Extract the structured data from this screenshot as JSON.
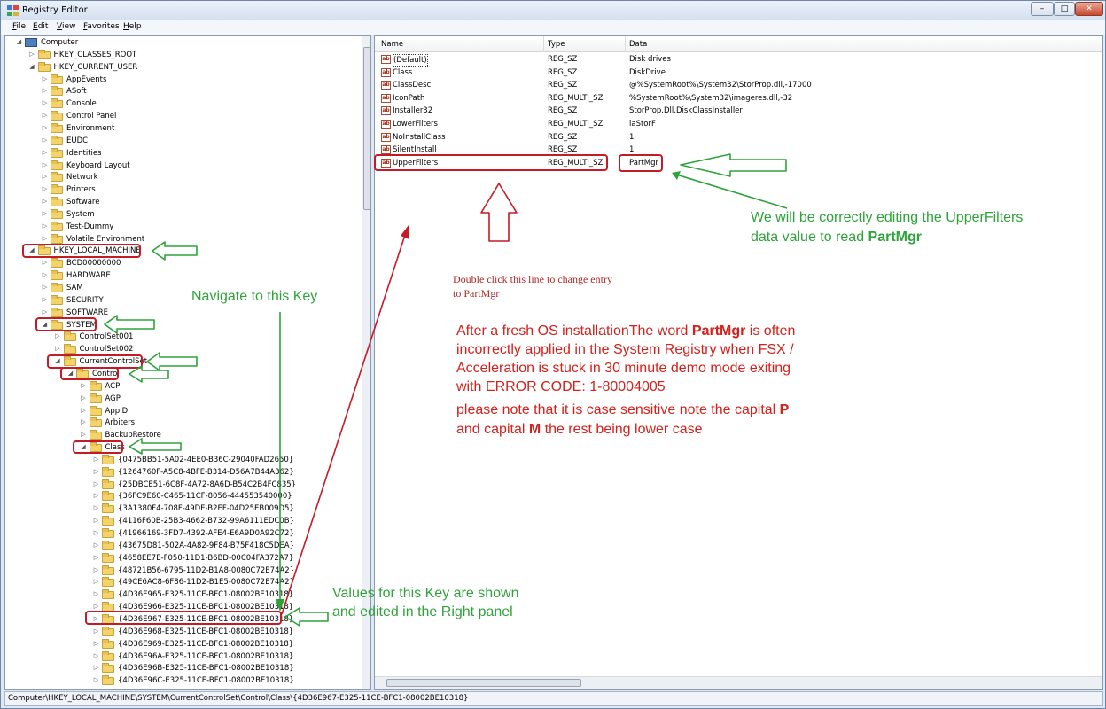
{
  "window": {
    "title": "Registry Editor",
    "controls": {
      "minimize": "–",
      "maximize": "□",
      "close": "✕"
    }
  },
  "menu": [
    {
      "label": "File",
      "mnemonic": "F",
      "rest": "ile"
    },
    {
      "label": "Edit",
      "mnemonic": "E",
      "rest": "dit"
    },
    {
      "label": "View",
      "mnemonic": "V",
      "rest": "iew"
    },
    {
      "label": "Favorites",
      "mnemonic": "F",
      "rest": "avorites"
    },
    {
      "label": "Help",
      "mnemonic": "H",
      "rest": "elp"
    }
  ],
  "tree": {
    "computer": "Computer",
    "hkcr": "HKEY_CLASSES_ROOT",
    "hkcu": "HKEY_CURRENT_USER",
    "hkcu_children": [
      "AppEvents",
      "ASoft",
      "Console",
      "Control Panel",
      "Environment",
      "EUDC",
      "Identities",
      "Keyboard Layout",
      "Network",
      "Printers",
      "Software",
      "System",
      "Test-Dummy",
      "Volatile Environment"
    ],
    "hklm": "HKEY_LOCAL_MACHINE",
    "hklm_children_before": [
      "BCD00000000",
      "HARDWARE",
      "SAM",
      "SECURITY",
      "SOFTWARE"
    ],
    "system": "SYSTEM",
    "cs001": "ControlSet001",
    "cs002": "ControlSet002",
    "ccs": "CurrentControlSet",
    "control": "Control",
    "control_children": [
      "ACPI",
      "AGP",
      "AppID",
      "Arbiters",
      "BackupRestore"
    ],
    "class": "Class",
    "class_children": [
      "{0475BB51-5A02-4EE0-B36C-29040FAD2650}",
      "{1264760F-A5C8-4BFE-B314-D56A7B44A362}",
      "{25DBCE51-6C8F-4A72-8A6D-B54C2B4FC835}",
      "{36FC9E60-C465-11CF-8056-444553540000}",
      "{3A1380F4-708F-49DE-B2EF-04D25EB009D5}",
      "{4116F60B-25B3-4662-B732-99A6111EDC0B}",
      "{41966169-3FD7-4392-AFE4-E6A9D0A92C72}",
      "{43675D81-502A-4A82-9F84-B75F418C5DEA}",
      "{4658EE7E-F050-11D1-B6BD-00C04FA372A7}",
      "{48721B56-6795-11D2-B1A8-0080C72E74A2}",
      "{49CE6AC8-6F86-11D2-B1E5-0080C72E74A2}",
      "{4D36E965-E325-11CE-BFC1-08002BE10318}",
      "{4D36E966-E325-11CE-BFC1-08002BE10318}",
      "{4D36E967-E325-11CE-BFC1-08002BE10318}",
      "{4D36E968-E325-11CE-BFC1-08002BE10318}",
      "{4D36E969-E325-11CE-BFC1-08002BE10318}",
      "{4D36E96A-E325-11CE-BFC1-08002BE10318}",
      "{4D36E96B-E325-11CE-BFC1-08002BE10318}",
      "{4D36E96C-E325-11CE-BFC1-08002BE10318}"
    ]
  },
  "list": {
    "columns": [
      "Name",
      "Type",
      "Data"
    ],
    "rows": [
      {
        "name": "(Default)",
        "type": "REG_SZ",
        "data": "Disk drives"
      },
      {
        "name": "Class",
        "type": "REG_SZ",
        "data": "DiskDrive"
      },
      {
        "name": "ClassDesc",
        "type": "REG_SZ",
        "data": "@%SystemRoot%\\System32\\StorProp.dll,-17000"
      },
      {
        "name": "IconPath",
        "type": "REG_MULTI_SZ",
        "data": "%SystemRoot%\\System32\\imageres.dll,-32"
      },
      {
        "name": "Installer32",
        "type": "REG_SZ",
        "data": "StorProp.Dll,DiskClassInstaller"
      },
      {
        "name": "LowerFilters",
        "type": "REG_MULTI_SZ",
        "data": "iaStorF"
      },
      {
        "name": "NoInstallClass",
        "type": "REG_SZ",
        "data": "1"
      },
      {
        "name": "SilentInstall",
        "type": "REG_SZ",
        "data": "1"
      },
      {
        "name": "UpperFilters",
        "type": "REG_MULTI_SZ",
        "data": "PartMgr"
      }
    ]
  },
  "status": {
    "path": "Computer\\HKEY_LOCAL_MACHINE\\SYSTEM\\CurrentControlSet\\Control\\Class\\{4D36E967-E325-11CE-BFC1-08002BE10318}"
  },
  "annotations": {
    "upper_note_line1": "We will be correctly editing the UpperFilters",
    "upper_note_line2_prefix": "data value to read ",
    "upper_note_line2_bold": "PartMgr",
    "navigate": "Navigate to this Key",
    "double_click_line1": "Double click this line to change entry",
    "double_click_line2": "to  PartMgr",
    "para1_line1_prefix": "After a fresh OS installationThe word ",
    "para1_line1_bold": "PartMgr",
    "para1_line1_suffix": "  is often",
    "para1_line2": "incorrectly applied in the System Registry when FSX /",
    "para1_line3": "Acceleration is stuck in 30 minute demo mode exiting",
    "para1_line4": "with ERROR CODE: 1-80004005",
    "para2_line1_prefix": "please note that it is case sensitive note the capital ",
    "para2_line1_bold": "P",
    "para2_line2_prefix": "and capital ",
    "para2_line2_bold": "M",
    "para2_line2_suffix": " the rest being lower case",
    "values_line1": "Values for this Key are shown",
    "values_line2": "and edited in the Right panel"
  },
  "colors": {
    "annotation_green": "#2ea33a",
    "annotation_red": "#d3211c",
    "highlight_red": "#c61a26"
  }
}
